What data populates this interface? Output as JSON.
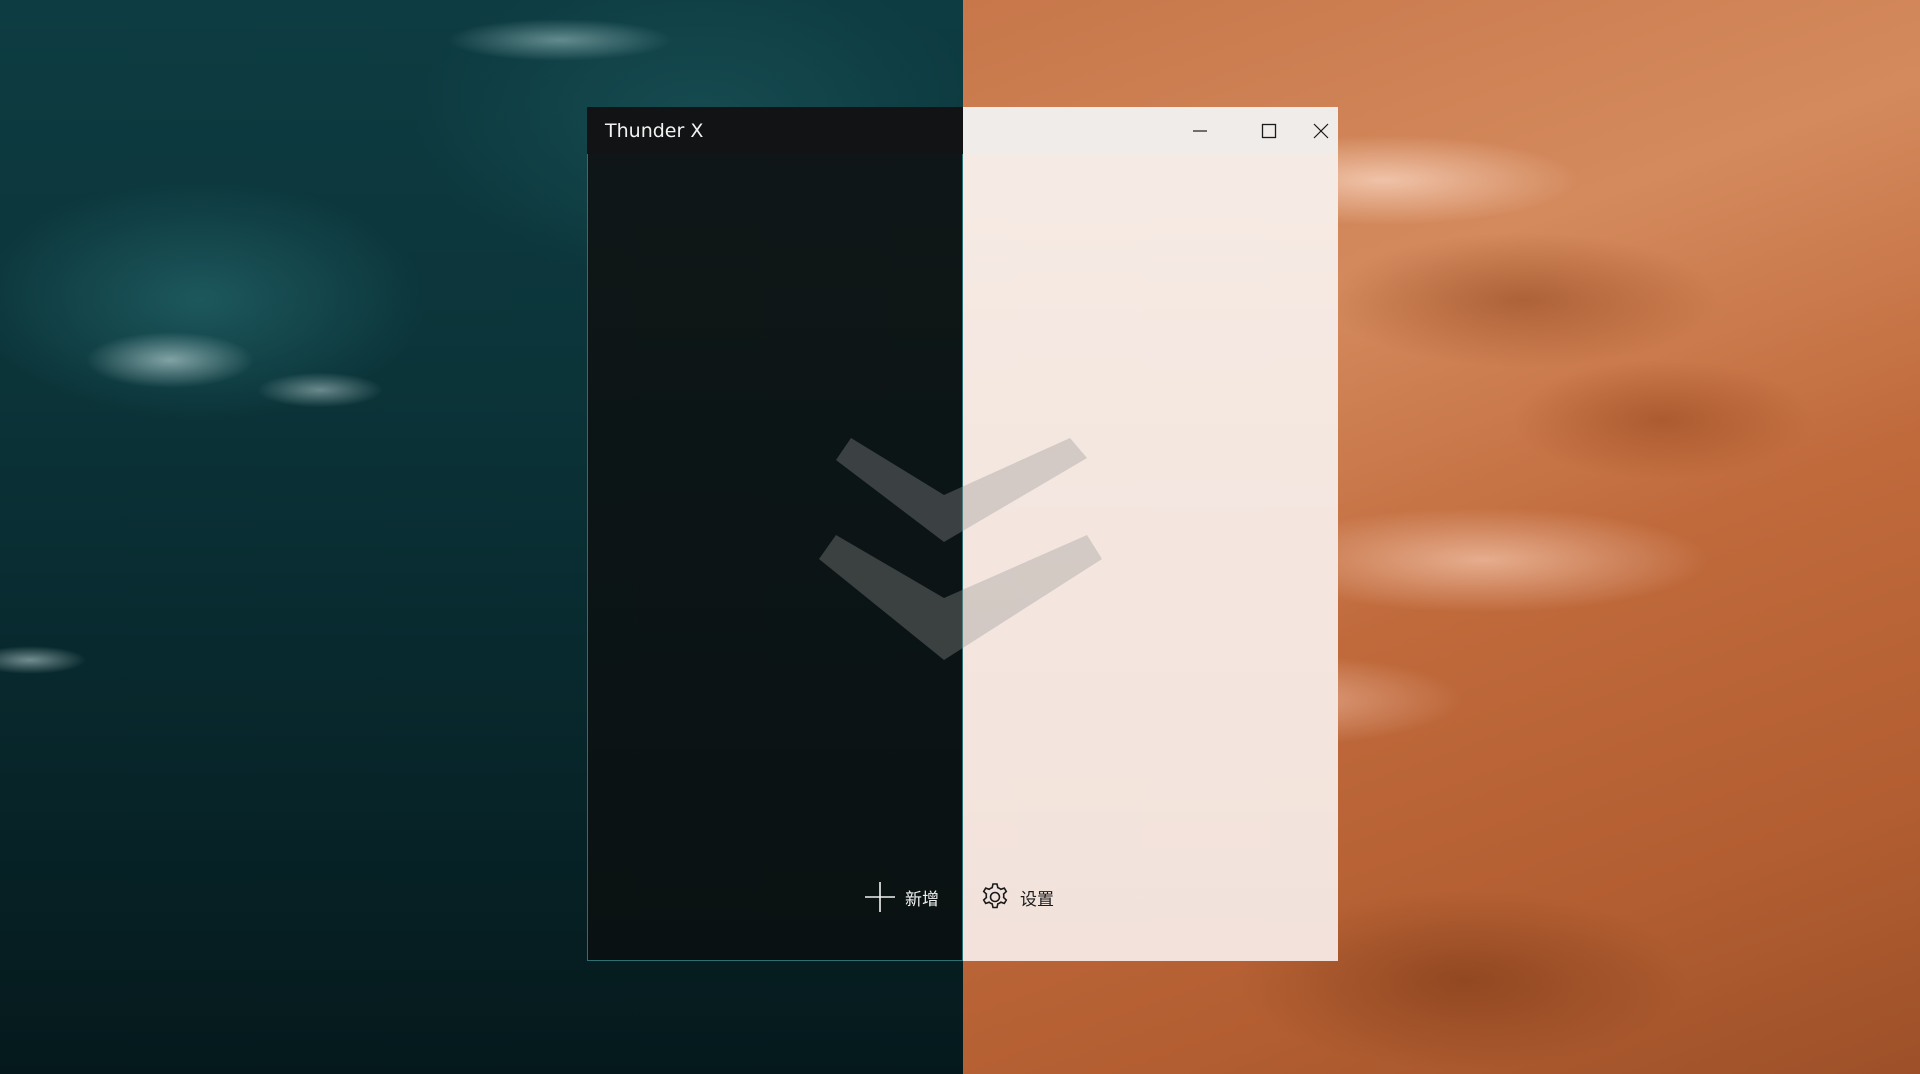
{
  "desktop": {
    "wallpaper_left": "water",
    "wallpaper_right": "sand-dunes"
  },
  "window": {
    "title": "Thunder X",
    "controls": {
      "minimize_icon": "minimize-icon",
      "maximize_icon": "maximize-icon",
      "close_icon": "close-icon"
    },
    "watermark_icon": "thunder-logo-icon",
    "toolbar": {
      "add_label": "新增",
      "add_icon": "plus-icon",
      "settings_label": "设置",
      "settings_icon": "gear-icon"
    }
  },
  "colors": {
    "dark_theme_bg": "#0c1516",
    "light_theme_bg": "#f4e6df",
    "dark_border": "#2e6f72"
  }
}
